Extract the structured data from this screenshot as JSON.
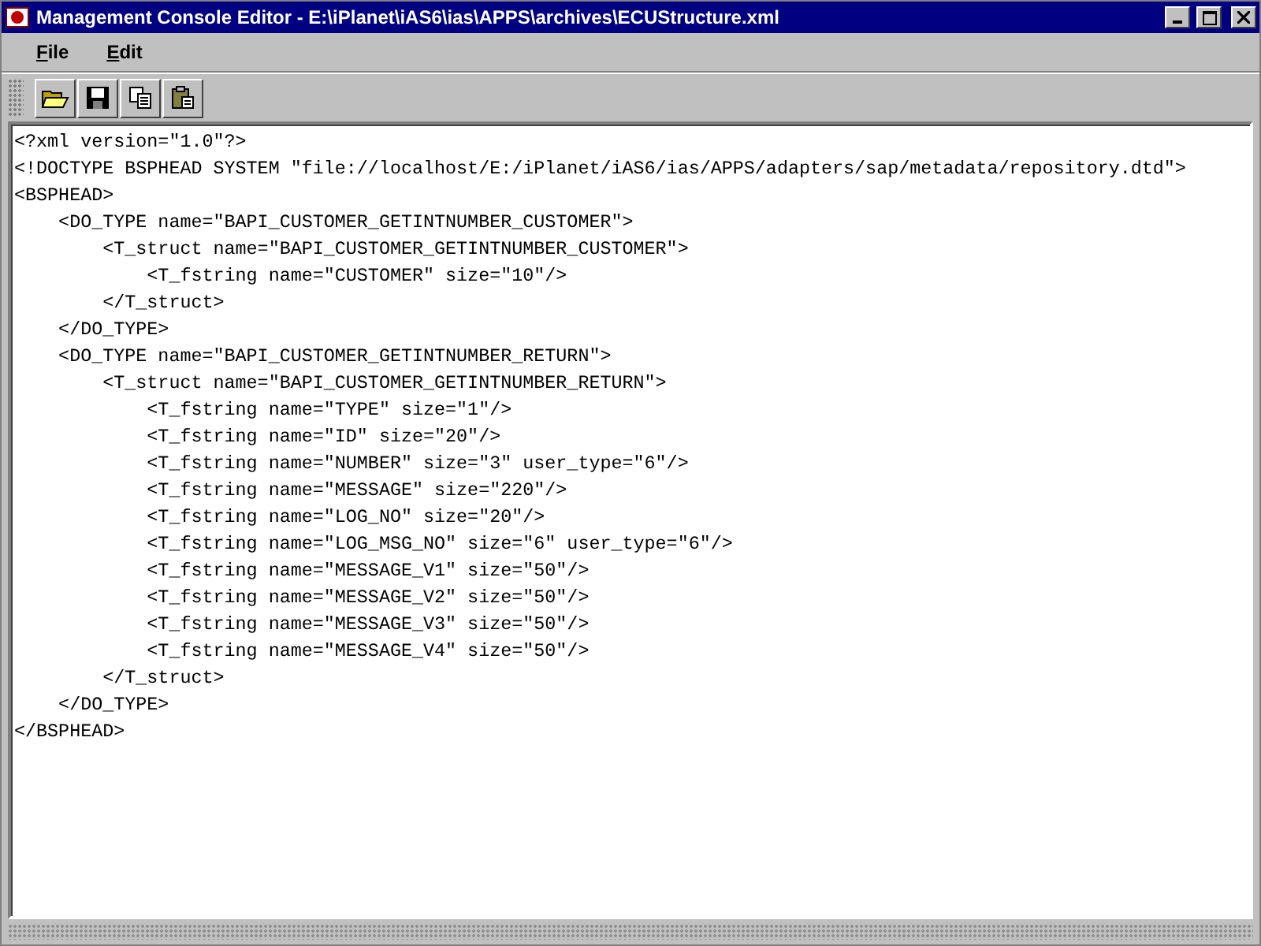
{
  "window": {
    "title": "Management Console Editor - E:\\iPlanet\\iAS6\\ias\\APPS\\archives\\ECUStructure.xml"
  },
  "menu": [
    {
      "label": "File"
    },
    {
      "label": "Edit"
    }
  ],
  "editor": {
    "lines": [
      "<?xml version=\"1.0\"?>",
      "<!DOCTYPE BSPHEAD SYSTEM \"file://localhost/E:/iPlanet/iAS6/ias/APPS/adapters/sap/metadata/repository.dtd\">",
      "<BSPHEAD>",
      "    <DO_TYPE name=\"BAPI_CUSTOMER_GETINTNUMBER_CUSTOMER\">",
      "        <T_struct name=\"BAPI_CUSTOMER_GETINTNUMBER_CUSTOMER\">",
      "            <T_fstring name=\"CUSTOMER\" size=\"10\"/>",
      "        </T_struct>",
      "    </DO_TYPE>",
      "    <DO_TYPE name=\"BAPI_CUSTOMER_GETINTNUMBER_RETURN\">",
      "        <T_struct name=\"BAPI_CUSTOMER_GETINTNUMBER_RETURN\">",
      "            <T_fstring name=\"TYPE\" size=\"1\"/>",
      "            <T_fstring name=\"ID\" size=\"20\"/>",
      "            <T_fstring name=\"NUMBER\" size=\"3\" user_type=\"6\"/>",
      "            <T_fstring name=\"MESSAGE\" size=\"220\"/>",
      "            <T_fstring name=\"LOG_NO\" size=\"20\"/>",
      "            <T_fstring name=\"LOG_MSG_NO\" size=\"6\" user_type=\"6\"/>",
      "            <T_fstring name=\"MESSAGE_V1\" size=\"50\"/>",
      "            <T_fstring name=\"MESSAGE_V2\" size=\"50\"/>",
      "            <T_fstring name=\"MESSAGE_V3\" size=\"50\"/>",
      "            <T_fstring name=\"MESSAGE_V4\" size=\"50\"/>",
      "        </T_struct>",
      "    </DO_TYPE>",
      "</BSPHEAD>"
    ]
  }
}
